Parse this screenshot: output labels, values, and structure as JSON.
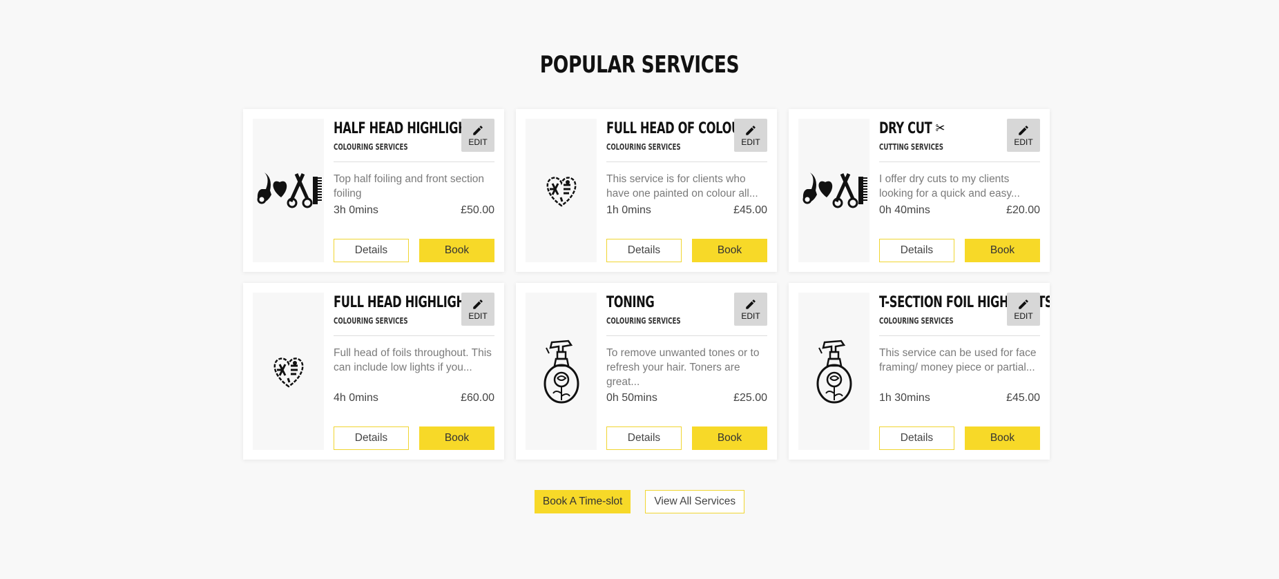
{
  "section": {
    "title": "POPULAR SERVICES"
  },
  "edit_label": "EDIT",
  "services": [
    {
      "title": "HALF HEAD HIGHLIGHT",
      "category": "COLOURING SERVICES",
      "description": "Top half foiling and front section foiling",
      "duration": "3h 0mins",
      "price": "£50.00",
      "details_label": "Details",
      "book_label": "Book",
      "image": "love-hairdressing-tools-icon"
    },
    {
      "title": "FULL HEAD OF COLOUR",
      "category": "COLOURING SERVICES",
      "description": "This service is for clients who have one painted on colour all...",
      "duration": "1h 0mins",
      "price": "£45.00",
      "details_label": "Details",
      "book_label": "Book",
      "image": "heart-tools-icon"
    },
    {
      "title": "DRY CUT ✂",
      "category": "CUTTING SERVICES",
      "description": "I offer dry cuts to my clients looking for a quick and easy...",
      "duration": "0h 40mins",
      "price": "£20.00",
      "details_label": "Details",
      "book_label": "Book",
      "image": "love-hairdressing-tools-icon"
    },
    {
      "title": "FULL HEAD HIGHLIGHTS",
      "category": "COLOURING SERVICES",
      "description": "Full head of foils throughout. This can include low lights if you...",
      "duration": "4h 0mins",
      "price": "£60.00",
      "details_label": "Details",
      "book_label": "Book",
      "image": "heart-tools-icon"
    },
    {
      "title": "TONING",
      "category": "COLOURING SERVICES",
      "description": "To remove unwanted tones or to refresh your hair. Toners are great...",
      "duration": "0h 50mins",
      "price": "£25.00",
      "details_label": "Details",
      "book_label": "Book",
      "image": "spray-bottle-rose-icon"
    },
    {
      "title": "T-SECTION FOIL HIGHLIGHTS",
      "category": "COLOURING SERVICES",
      "description": "This service can be used for face framing/ money piece or partial...",
      "duration": "1h 30mins",
      "price": "£45.00",
      "details_label": "Details",
      "book_label": "Book",
      "image": "spray-bottle-rose-icon"
    }
  ],
  "footer": {
    "book_timeslot_label": "Book A Time-slot",
    "view_all_label": "View All Services"
  },
  "colors": {
    "accent": "#f7d928",
    "background": "#f8f8f8",
    "edit_bg": "#d7d7d7"
  }
}
